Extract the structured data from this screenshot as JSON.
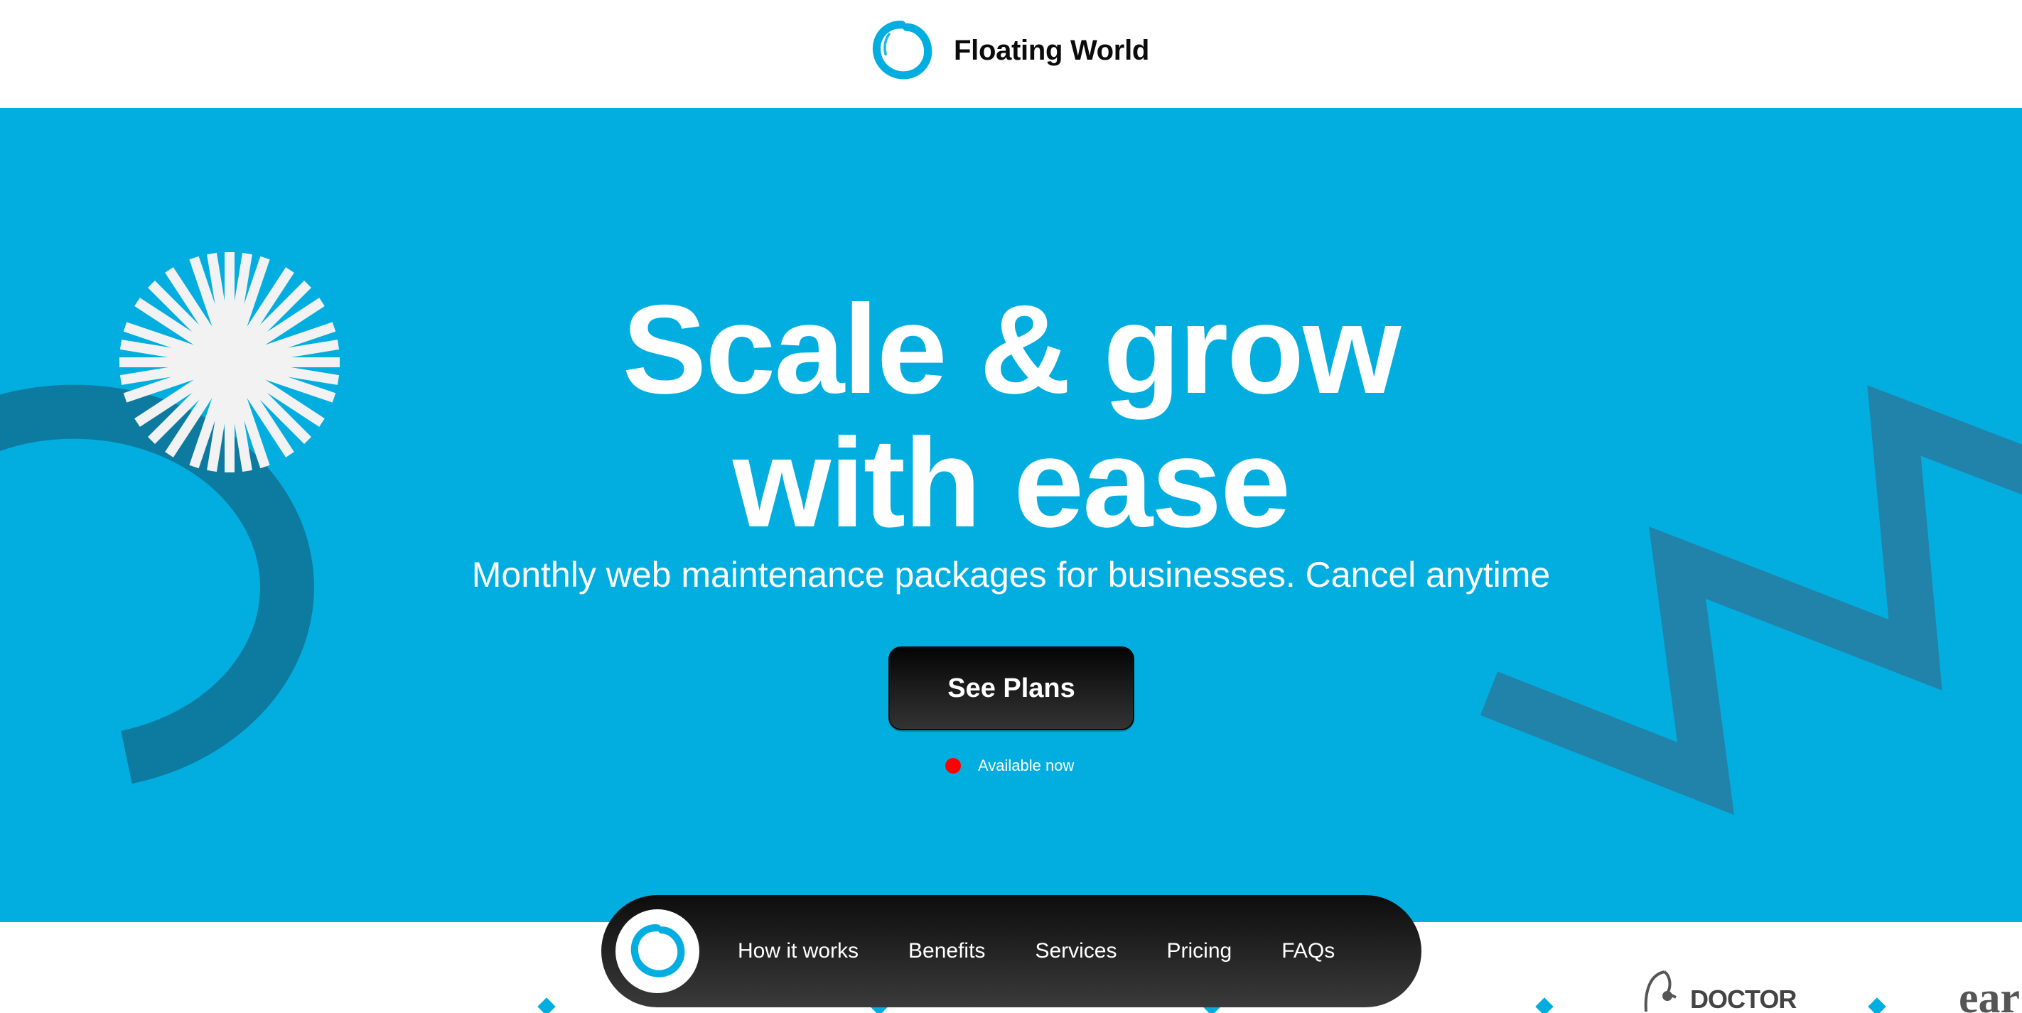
{
  "brand": {
    "name": "Floating World",
    "logo_icon": "enso-circle-icon"
  },
  "hero": {
    "title_line1": "Scale & grow",
    "title_line2": "with ease",
    "subtitle": "Monthly web maintenance packages for businesses. Cancel anytime",
    "cta_label": "See Plans",
    "status_text": "Available now",
    "status_color": "#ff0000"
  },
  "nav": {
    "items": [
      {
        "label": "How it works"
      },
      {
        "label": "Benefits"
      },
      {
        "label": "Services"
      },
      {
        "label": "Pricing"
      },
      {
        "label": "FAQs"
      }
    ]
  },
  "partners": {
    "visible": [
      "DOCTOR",
      "ear"
    ]
  },
  "colors": {
    "accent": "#02aee0",
    "deco_shape": "#0d7aa0",
    "deco_zigzag": "#2183aa",
    "button_bg": "#111111",
    "header_bg": "#ffffff"
  }
}
